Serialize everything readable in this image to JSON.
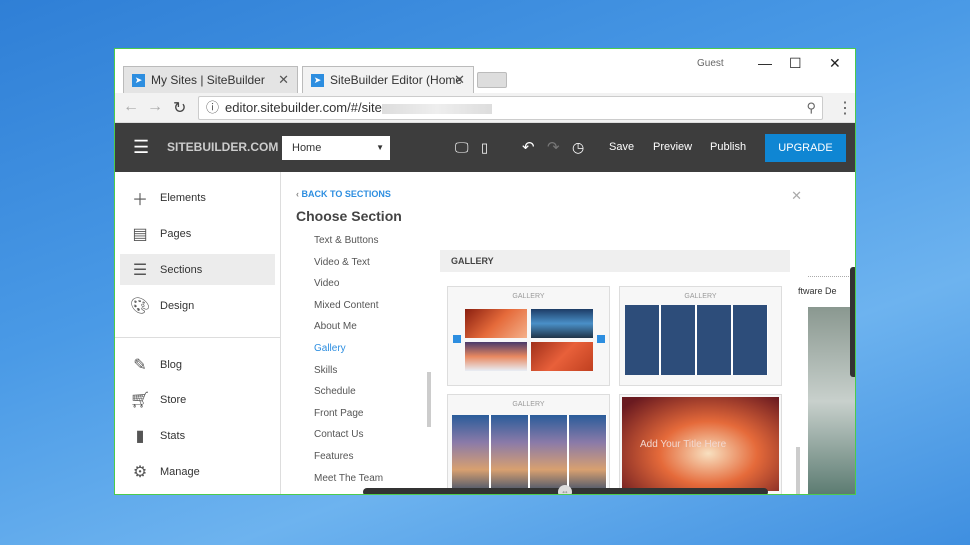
{
  "browser": {
    "tabs": [
      {
        "label": "My Sites | SiteBuilder",
        "active": false
      },
      {
        "label": "SiteBuilder Editor (Home",
        "active": true
      }
    ],
    "user": "Guest",
    "url": "editor.sitebuilder.com/#/site"
  },
  "toolbar": {
    "logo": "SITEBUILDER.COM",
    "page_select": "Home",
    "save": "Save",
    "preview": "Preview",
    "publish": "Publish",
    "upgrade": "UPGRADE",
    "accent": "#0f86d3"
  },
  "sidebar": {
    "items": [
      {
        "label": "Elements",
        "icon": "plus-icon"
      },
      {
        "label": "Pages",
        "icon": "pages-icon"
      },
      {
        "label": "Sections",
        "icon": "sections-icon",
        "selected": true
      },
      {
        "label": "Design",
        "icon": "palette-icon"
      },
      {
        "label": "Blog",
        "icon": "pencil-icon"
      },
      {
        "label": "Store",
        "icon": "cart-icon"
      },
      {
        "label": "Stats",
        "icon": "bar-chart-icon"
      },
      {
        "label": "Manage",
        "icon": "gear-icon"
      }
    ]
  },
  "panel": {
    "back": "BACK TO SECTIONS",
    "title": "Choose Section",
    "categories": [
      "Text & Buttons",
      "Video & Text",
      "Video",
      "Mixed Content",
      "About Me",
      "Gallery",
      "Skills",
      "Schedule",
      "Front Page",
      "Contact Us",
      "Features",
      "Meet The Team"
    ],
    "active_category": "Gallery",
    "group_header": "GALLERY",
    "card_label": "GALLERY",
    "slide_text": "Add Your Title Here"
  },
  "preview": {
    "text": "ftware De"
  }
}
